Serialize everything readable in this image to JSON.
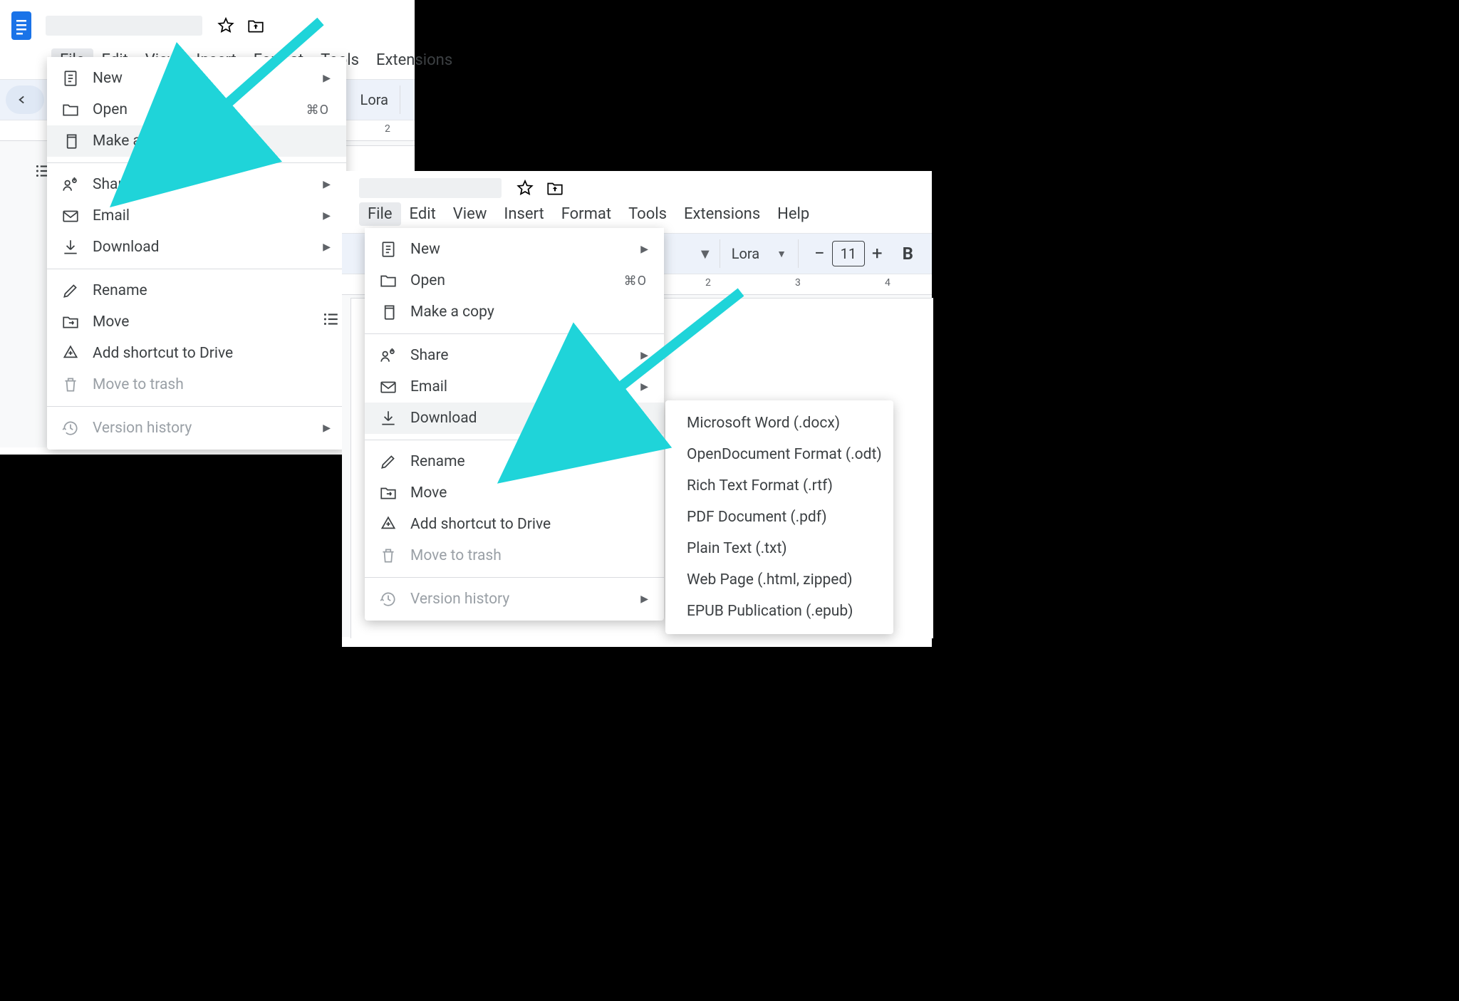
{
  "menubar": [
    "File",
    "Edit",
    "View",
    "Insert",
    "Format",
    "Tools",
    "Extensions"
  ],
  "menubar_b": [
    "File",
    "Edit",
    "View",
    "Insert",
    "Format",
    "Tools",
    "Extensions",
    "Help"
  ],
  "toolbar_a": {
    "font": "Lora"
  },
  "toolbar_b": {
    "font": "Lora",
    "size": "11",
    "bold": "B"
  },
  "ruler_a": [
    "2"
  ],
  "ruler_b": [
    "2",
    "3",
    "4"
  ],
  "file_menu": {
    "new": "New",
    "open": "Open",
    "open_shortcut": "⌘O",
    "copy": "Make a copy",
    "share": "Share",
    "email": "Email",
    "download": "Download",
    "rename": "Rename",
    "move": "Move",
    "shortcut": "Add shortcut to Drive",
    "trash": "Move to trash",
    "version": "Version history"
  },
  "download_submenu": [
    "Microsoft Word (.docx)",
    "OpenDocument Format (.odt)",
    "Rich Text Format (.rtf)",
    "PDF Document (.pdf)",
    "Plain Text (.txt)",
    "Web Page (.html, zipped)",
    "EPUB Publication (.epub)"
  ]
}
